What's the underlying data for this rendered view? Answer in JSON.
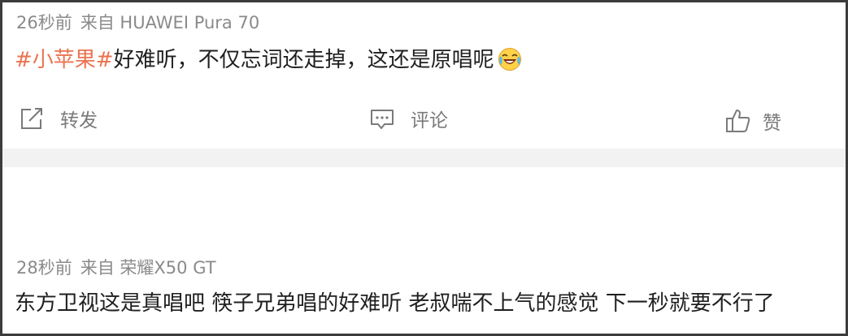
{
  "posts": [
    {
      "time": "26秒前",
      "source": "来自 HUAWEI Pura 70",
      "hashtag": "#小苹果#",
      "text": "好难听，不仅忘词还走掉，这还是原唱呢",
      "emoji": "laugh-cry-emoji",
      "actions": {
        "repost": "转发",
        "comment": "评论",
        "like": "赞"
      }
    },
    {
      "time": "28秒前",
      "source": "来自 荣耀X50 GT",
      "text": "东方卫视这是真唱吧 筷子兄弟唱的好难听 老叔喘不上气的感觉 下一秒就要不行了"
    }
  ],
  "colors": {
    "hashtag": "#eb7350",
    "meta_text": "#8a8a8a",
    "body_text": "#1f1f1f",
    "action_text": "#7a7a7a",
    "divider": "#f2f2f2"
  }
}
